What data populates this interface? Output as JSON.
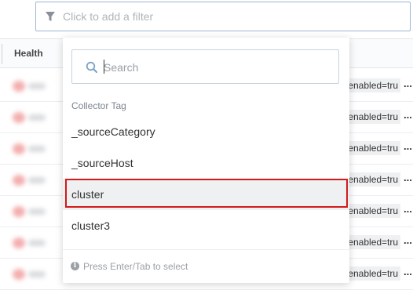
{
  "filter_bar": {
    "placeholder": "Click to add a filter",
    "icon": "filter-icon"
  },
  "table": {
    "header": {
      "health": "Health"
    },
    "rows": [
      {
        "tag": ".enabled=tru",
        "more": "..."
      },
      {
        "tag": ".enabled=tru",
        "more": "..."
      },
      {
        "tag": ".enabled=tru",
        "more": "..."
      },
      {
        "tag": ".enabled=tru",
        "more": "..."
      },
      {
        "tag": ".enabled=tru",
        "more": "..."
      },
      {
        "tag": ".enabled=tru",
        "more": "..."
      },
      {
        "tag": ".enabled=tru",
        "more": "..."
      }
    ]
  },
  "dropdown": {
    "search": {
      "placeholder": "Search",
      "value": "",
      "icon": "search-icon"
    },
    "group_label": "Collector Tag",
    "options": [
      {
        "label": "_sourceCategory"
      },
      {
        "label": "_sourceHost"
      },
      {
        "label": "cluster"
      },
      {
        "label": "cluster3"
      }
    ],
    "footer_hint": "Press Enter/Tab to select",
    "footer_icon": "info-icon",
    "highlight_color": "#d21a1a"
  }
}
